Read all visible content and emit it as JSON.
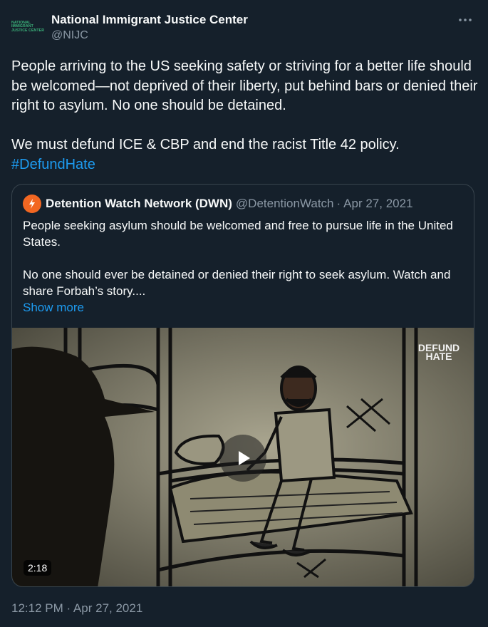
{
  "tweet": {
    "author": {
      "name": "National Immigrant Justice Center",
      "handle": "@NIJC",
      "avatar_text": [
        "NATIONAL",
        "IMMIGRANT",
        "JUSTICE CENTER"
      ]
    },
    "text": {
      "paragraph1": "People arriving to the US seeking safety or striving for a better life should be welcomed—not deprived of their liberty, put behind bars or denied their right to asylum. No one should be detained.",
      "paragraph2": "We must defund ICE & CBP and end the racist Title 42 policy.",
      "hashtag": "#DefundHate"
    },
    "timestamp": "12:12 PM · Apr 27, 2021"
  },
  "quote": {
    "author_name": "Detention Watch Network (DWN)",
    "handle": "@DetentionWatch",
    "separator": "·",
    "date": "Apr 27, 2021",
    "paragraph1": "People seeking asylum should be welcomed and free to pursue life in the United States.",
    "paragraph2": "No one should ever be detained or denied their right to seek asylum. Watch and share Forbah’s story....",
    "show_more": "Show more",
    "video": {
      "duration": "2:18",
      "badge_line1": "DEFUND",
      "badge_line2": "HATE"
    }
  },
  "icons": {
    "more": "more-horizontal-icon",
    "play": "play-icon",
    "quote_avatar": "detention-watch-logo-icon"
  },
  "colors": {
    "background": "#15202b",
    "link": "#1d9bf0",
    "secondary_text": "#8b98a5",
    "border": "#38444d",
    "logo_green": "#3bb37a",
    "quote_avatar_orange": "#f26722"
  }
}
